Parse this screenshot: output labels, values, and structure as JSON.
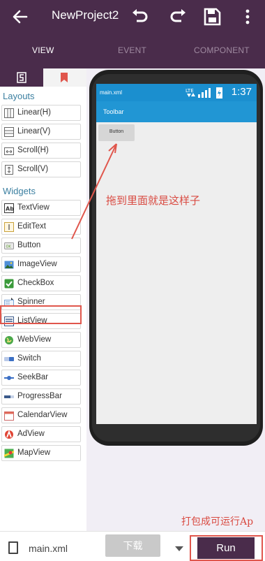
{
  "header": {
    "title": "NewProject2",
    "icons": [
      "back-arrow-icon",
      "undo-icon",
      "redo-icon",
      "save-icon",
      "more-vert-icon"
    ]
  },
  "tabs": [
    {
      "label": "VIEW",
      "active": true
    },
    {
      "label": "EVENT",
      "active": false
    },
    {
      "label": "COMPONENT",
      "active": false
    }
  ],
  "palette": {
    "sections": {
      "layouts": "Layouts",
      "widgets": "Widgets"
    },
    "layouts": [
      {
        "label": "Linear(H)",
        "icon": "linear-h-icon"
      },
      {
        "label": "Linear(V)",
        "icon": "linear-v-icon"
      },
      {
        "label": "Scroll(H)",
        "icon": "scroll-h-icon"
      },
      {
        "label": "Scroll(V)",
        "icon": "scroll-v-icon"
      }
    ],
    "widgets": [
      {
        "label": "TextView",
        "icon": "textview-icon"
      },
      {
        "label": "EditText",
        "icon": "edittext-icon"
      },
      {
        "label": "Button",
        "icon": "button-icon"
      },
      {
        "label": "ImageView",
        "icon": "imageview-icon"
      },
      {
        "label": "CheckBox",
        "icon": "checkbox-icon"
      },
      {
        "label": "Spinner",
        "icon": "spinner-icon"
      },
      {
        "label": "ListView",
        "icon": "listview-icon"
      },
      {
        "label": "WebView",
        "icon": "webview-icon"
      },
      {
        "label": "Switch",
        "icon": "switch-icon"
      },
      {
        "label": "SeekBar",
        "icon": "seekbar-icon"
      },
      {
        "label": "ProgressBar",
        "icon": "progressbar-icon"
      },
      {
        "label": "CalendarView",
        "icon": "calendarview-icon"
      },
      {
        "label": "AdView",
        "icon": "adview-icon"
      },
      {
        "label": "MapView",
        "icon": "mapview-icon"
      }
    ]
  },
  "preview": {
    "filename": "main.xml",
    "status_time": "1:37",
    "network": "LTE",
    "toolbar_title": "Toolbar",
    "button_label": "Button"
  },
  "annotations": {
    "drag_note": "拖到里面就是这样子",
    "run_note": "打包成可运行Ap"
  },
  "bottom": {
    "filename": "main.xml",
    "download_label": "下载",
    "run_label": "Run"
  },
  "colors": {
    "primary": "#4a2c4b",
    "accent_blue": "#2196d4",
    "annotation_red": "#e0564c"
  }
}
